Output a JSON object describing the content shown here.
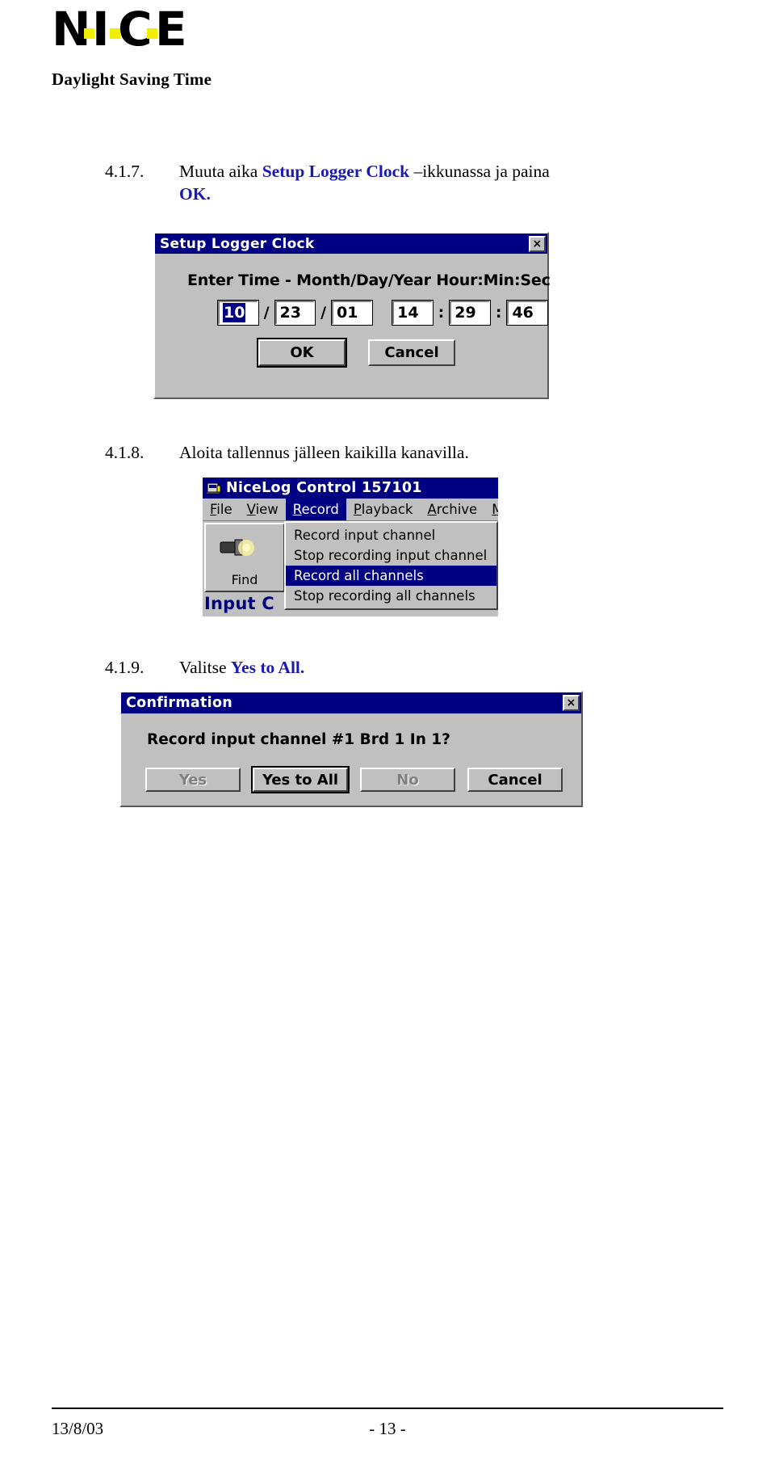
{
  "header": {
    "logo_letters": [
      "N",
      "I",
      "C",
      "E"
    ],
    "logo_alt": "NICE",
    "subtitle": "Daylight Saving Time"
  },
  "steps": [
    {
      "number": "4.1.7.",
      "text_parts": [
        {
          "t": "Muuta aika ",
          "style": "plain"
        },
        {
          "t": "Setup Logger Clock",
          "style": "kw"
        },
        {
          "t": " –ikkunassa ja paina ",
          "style": "plain"
        },
        {
          "t": "OK.",
          "style": "kw"
        }
      ],
      "plain1": "Muuta aika ",
      "kw1": "Setup Logger Clock",
      "plain2": " –ikkunassa ja paina ",
      "kw2": "OK."
    },
    {
      "number": "4.1.8.",
      "plain1": "Aloita tallennus jälleen kaikilla kanavilla.",
      "kw1": "",
      "plain2": "",
      "kw2": ""
    },
    {
      "number": "4.1.9.",
      "plain1": "Valitse ",
      "kw1": "Yes to All.",
      "plain2": "",
      "kw2": ""
    }
  ],
  "clock_dialog": {
    "title": "Setup Logger Clock",
    "close_label": "×",
    "prompt": "Enter Time - Month/Day/Year Hour:Min:Sec",
    "month": "10",
    "day": "23",
    "year": "01",
    "hour": "14",
    "minute": "29",
    "second": "46",
    "sep_date": "/",
    "sep_time": ":",
    "ok_label": "OK",
    "cancel_label": "Cancel",
    "selected_field": "month",
    "selection_color": "#000082"
  },
  "nicelog_window": {
    "title": "NiceLog Control 157101",
    "icon_name": "nicelog-app-icon",
    "menus": [
      {
        "label": "File",
        "accel": "F",
        "open": false
      },
      {
        "label": "View",
        "accel": "V",
        "open": false
      },
      {
        "label": "Record",
        "accel": "R",
        "open": true
      },
      {
        "label": "Playback",
        "accel": "P",
        "open": false
      },
      {
        "label": "Archive",
        "accel": "A",
        "open": false
      },
      {
        "label": "Mai",
        "accel": "M",
        "open": false
      }
    ],
    "menu_items": [
      {
        "label": "Record input channel",
        "selected": false
      },
      {
        "label": "Stop recording input channel",
        "selected": false
      },
      {
        "label": "Record all channels",
        "selected": true
      },
      {
        "label": "Stop recording all channels",
        "selected": false
      }
    ],
    "toolbar_find_label": "Find",
    "partial_text": "Input C"
  },
  "confirm_dialog": {
    "title": "Confirmation",
    "close_label": "×",
    "message": "Record input channel #1 Brd 1 In 1?",
    "buttons": [
      {
        "label": "Yes",
        "state": "disabled"
      },
      {
        "label": "Yes to All",
        "state": "default"
      },
      {
        "label": "No",
        "state": "disabled"
      },
      {
        "label": "Cancel",
        "state": "normal"
      }
    ]
  },
  "footer": {
    "date": "13/8/03",
    "page": "- 13 -"
  },
  "colors": {
    "keyword_blue": "#1a1ab0",
    "titlebar_blue": "#000082",
    "logo_yellow": "#f2ee00",
    "win_face": "#c0c0c0"
  }
}
